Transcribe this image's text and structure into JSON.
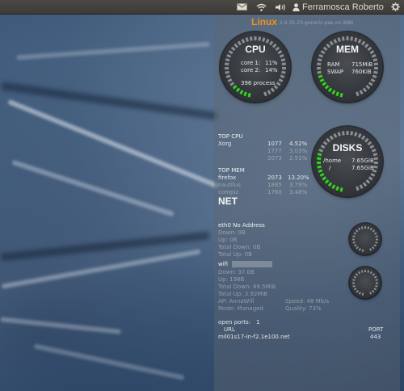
{
  "panel": {
    "mail_icon": "envelope-icon",
    "wifi_icon": "wifi-icon",
    "volume_icon": "speaker-icon",
    "user_icon": "person-icon",
    "user_name": "Ferramosca Roberto",
    "settings_icon": "gear-icon"
  },
  "conky": {
    "os": "Linux",
    "kernel": "2.6.35-23-generic-pae on i686",
    "cpu": {
      "title": "CPU",
      "core1_label": "core 1:",
      "core1_value": "11%",
      "core2_label": "core 2:",
      "core2_value": "14%",
      "processes": "396 process",
      "level": 0.13
    },
    "mem": {
      "title": "MEM",
      "ram_label": "RAM",
      "ram_value": "715MiB",
      "swap_label": "SWAP",
      "swap_value": "760KiB",
      "level": 0.2
    },
    "top_cpu": {
      "title": "TOP CPU",
      "rows": [
        {
          "name": "Xorg",
          "pid": "1077",
          "value": "4.52%"
        },
        {
          "name": "",
          "pid": "1777",
          "value": "3.03%"
        },
        {
          "name": "",
          "pid": "2073",
          "value": "2.51%"
        }
      ]
    },
    "top_mem": {
      "title": "TOP MEM",
      "rows": [
        {
          "name": "firefox",
          "pid": "2073",
          "value": "13.20%"
        },
        {
          "name": "nautilus",
          "pid": "1885",
          "value": "3.79%"
        },
        {
          "name": "compiz",
          "pid": "1760",
          "value": "3.48%"
        }
      ]
    },
    "disks": {
      "title": "DISKS",
      "rows": [
        {
          "mount": "/home",
          "value": "7.65GiB"
        },
        {
          "mount": "/",
          "value": "7.65GiB"
        }
      ],
      "level": 0.3
    },
    "net": {
      "title": "NET",
      "eth0": {
        "header": "eth0 No Address",
        "down": "Down: 0B",
        "up": "Up: 0B",
        "total_down": "Total Down: 0B",
        "total_up": "Total Up: 0B"
      },
      "wifi": {
        "header": "wifi",
        "down": "Down: 37.0B",
        "up": "Up: 198B",
        "total_down": "Total Down: 69.5MiB",
        "total_up": "Total Up: 3.92MiB",
        "ap": "AP: AnnaWifi",
        "mode": "Mode: Managed",
        "speed": "Speed: 48 Mb/s",
        "quality": "Quality: 73%"
      },
      "open_ports_label": "open ports:",
      "open_ports_count": "1",
      "url_label": "URL",
      "port_label": "PORT",
      "url_value": "mil01s17-in-f2.1e100.net",
      "port_value": "443"
    }
  }
}
